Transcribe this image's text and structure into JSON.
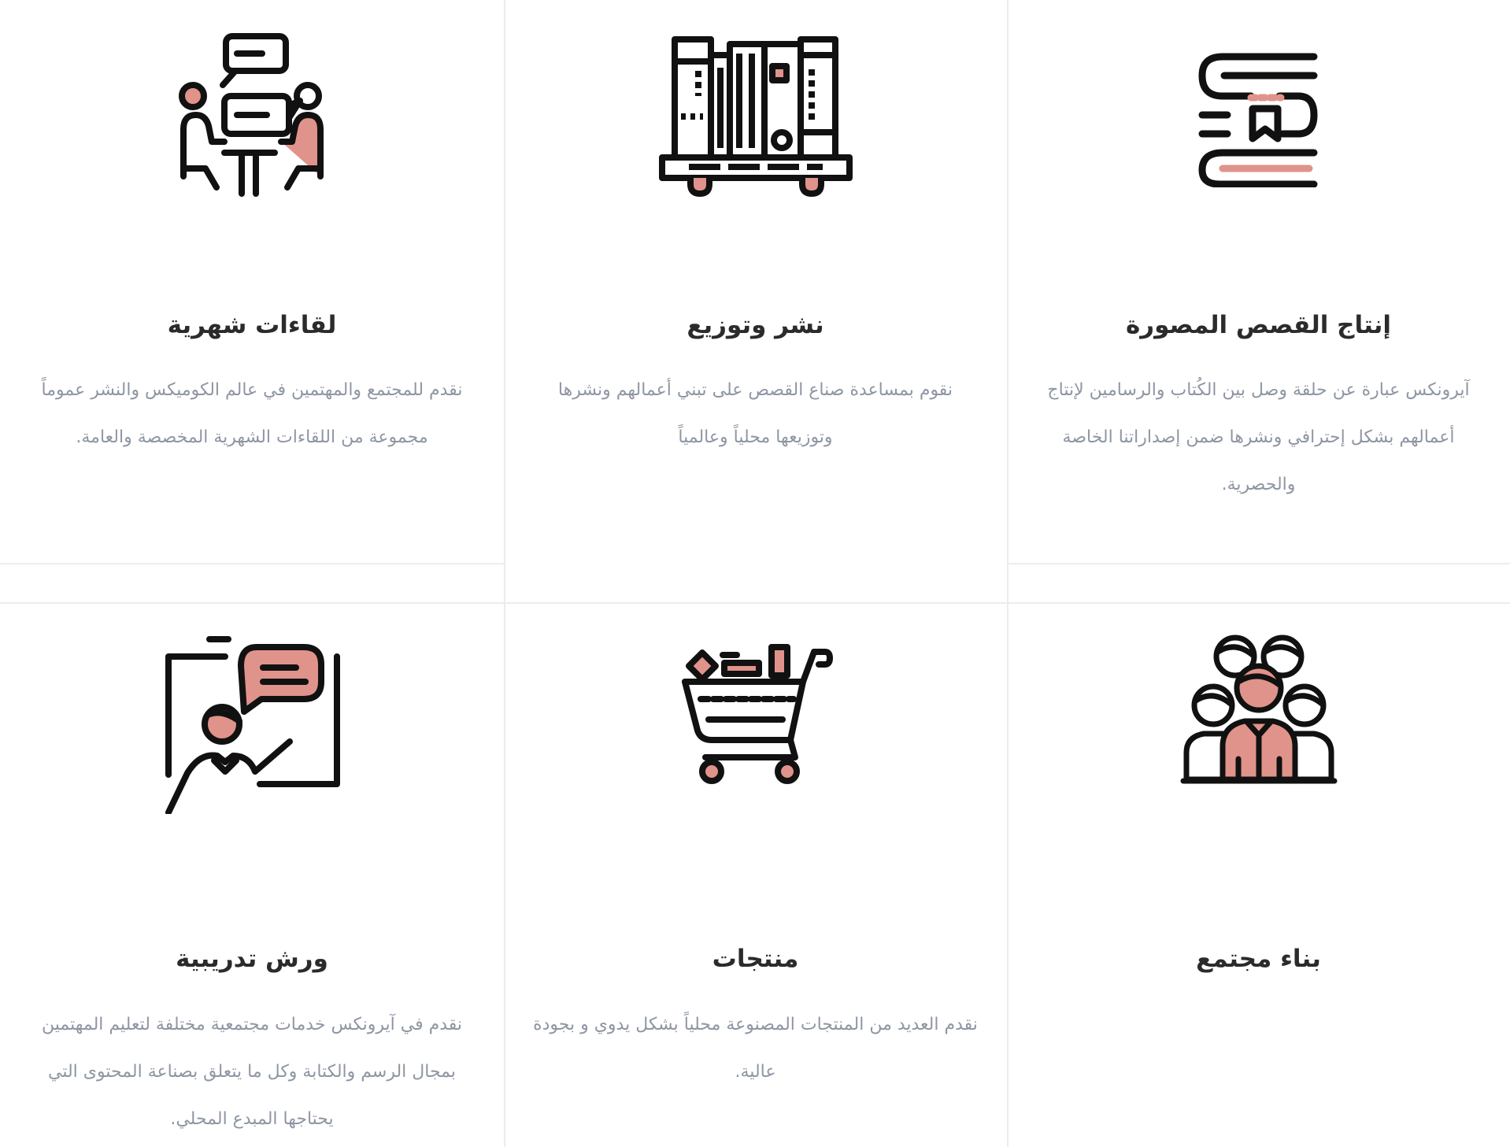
{
  "colors": {
    "accent": "#e0938a",
    "stroke": "#111111",
    "title": "#2b2b2b",
    "text": "#8e96a3",
    "divider": "#ececec"
  },
  "services": [
    {
      "icon": "meeting-icon",
      "title": "لقاءات شهرية",
      "description": "نقدم للمجتمع والمهتمين في عالم الكوميكس والنشر عموماً مجموعة من اللقاءات الشهرية المخصصة والعامة."
    },
    {
      "icon": "bookshelf-cart-icon",
      "title": "نشر وتوزيع",
      "description": "نقوم بمساعدة صناع القصص على تبني أعمالهم ونشرها وتوزيعها محلياً وعالمياً"
    },
    {
      "icon": "book-production-icon",
      "title": "إنتاج القصص المصورة",
      "description": "آيرونكس عبارة عن حلقة وصل بين الكُتاب والرسامين لإنتاج أعمالهم بشكل إحترافي ونشرها ضمن إصداراتنا الخاصة والحصرية."
    },
    {
      "icon": "presentation-icon",
      "title": "ورش تدريبية",
      "description": "نقدم في آيرونكس خدمات مجتمعية مختلفة لتعليم المهتمين بمجال الرسم والكتابة وكل ما يتعلق بصناعة المحتوى التي يحتاجها المبدع المحلي."
    },
    {
      "icon": "shopping-cart-icon",
      "title": "منتجات",
      "description": "نقدم العديد من المنتجات المصنوعة محلياً بشكل يدوي و بجودة عالية."
    },
    {
      "icon": "community-icon",
      "title": "بناء مجتمع",
      "description": ""
    }
  ]
}
